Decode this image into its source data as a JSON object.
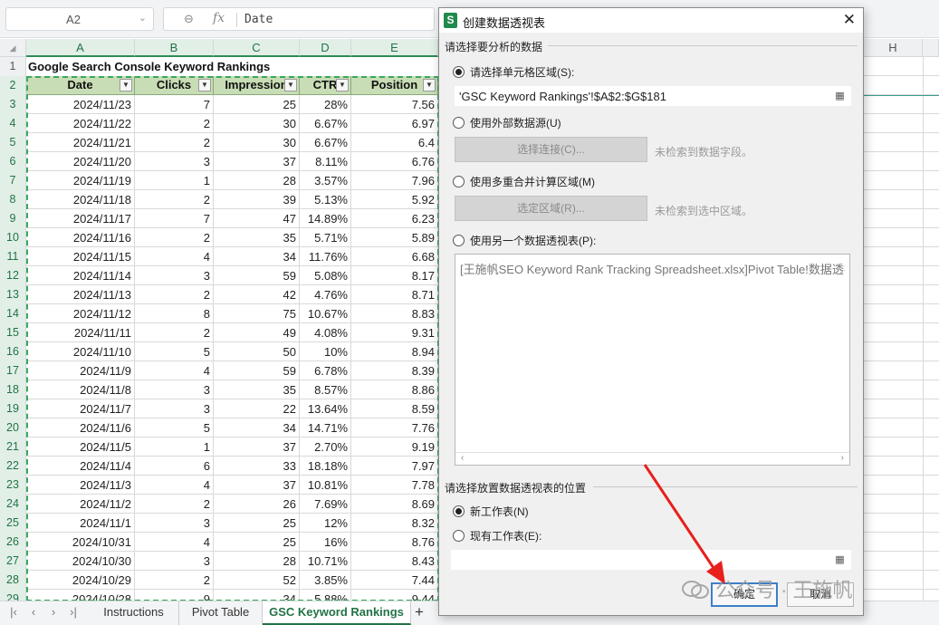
{
  "formula_bar": {
    "name_box": "A2",
    "formula_value": "Date",
    "zoom_icon": "zoom-icon",
    "fx_label": "fx"
  },
  "columns": [
    "A",
    "B",
    "C",
    "D",
    "E",
    "H"
  ],
  "spreadsheet": {
    "title": "Google Search Console Keyword Rankings",
    "headers": [
      "Date",
      "Clicks",
      "Impression",
      "CTR",
      "Position"
    ],
    "row_numbers": [
      "1",
      "2",
      "3",
      "4",
      "5",
      "6",
      "7",
      "8",
      "9",
      "10",
      "11",
      "12",
      "13",
      "14",
      "15",
      "16",
      "17",
      "18",
      "19",
      "20",
      "21",
      "22",
      "23",
      "24",
      "25",
      "26",
      "27",
      "28",
      "29"
    ],
    "rows": [
      [
        "2024/11/23",
        "7",
        "25",
        "28%",
        "7.56"
      ],
      [
        "2024/11/22",
        "2",
        "30",
        "6.67%",
        "6.97"
      ],
      [
        "2024/11/21",
        "2",
        "30",
        "6.67%",
        "6.4"
      ],
      [
        "2024/11/20",
        "3",
        "37",
        "8.11%",
        "6.76"
      ],
      [
        "2024/11/19",
        "1",
        "28",
        "3.57%",
        "7.96"
      ],
      [
        "2024/11/18",
        "2",
        "39",
        "5.13%",
        "5.92"
      ],
      [
        "2024/11/17",
        "7",
        "47",
        "14.89%",
        "6.23"
      ],
      [
        "2024/11/16",
        "2",
        "35",
        "5.71%",
        "5.89"
      ],
      [
        "2024/11/15",
        "4",
        "34",
        "11.76%",
        "6.68"
      ],
      [
        "2024/11/14",
        "3",
        "59",
        "5.08%",
        "8.17"
      ],
      [
        "2024/11/13",
        "2",
        "42",
        "4.76%",
        "8.71"
      ],
      [
        "2024/11/12",
        "8",
        "75",
        "10.67%",
        "8.83"
      ],
      [
        "2024/11/11",
        "2",
        "49",
        "4.08%",
        "9.31"
      ],
      [
        "2024/11/10",
        "5",
        "50",
        "10%",
        "8.94"
      ],
      [
        "2024/11/9",
        "4",
        "59",
        "6.78%",
        "8.39"
      ],
      [
        "2024/11/8",
        "3",
        "35",
        "8.57%",
        "8.86"
      ],
      [
        "2024/11/7",
        "3",
        "22",
        "13.64%",
        "8.59"
      ],
      [
        "2024/11/6",
        "5",
        "34",
        "14.71%",
        "7.76"
      ],
      [
        "2024/11/5",
        "1",
        "37",
        "2.70%",
        "9.19"
      ],
      [
        "2024/11/4",
        "6",
        "33",
        "18.18%",
        "7.97"
      ],
      [
        "2024/11/3",
        "4",
        "37",
        "10.81%",
        "7.78"
      ],
      [
        "2024/11/2",
        "2",
        "26",
        "7.69%",
        "8.69"
      ],
      [
        "2024/11/1",
        "3",
        "25",
        "12%",
        "8.32"
      ],
      [
        "2024/10/31",
        "4",
        "25",
        "16%",
        "8.76"
      ],
      [
        "2024/10/30",
        "3",
        "28",
        "10.71%",
        "8.43"
      ],
      [
        "2024/10/29",
        "2",
        "52",
        "3.85%",
        "7.44"
      ],
      [
        "2024/10/28",
        "9",
        "34",
        "5.88%",
        "9.44"
      ]
    ]
  },
  "sheet_tabs": [
    "Instructions",
    "Pivot Table",
    "GSC Keyword Rankings"
  ],
  "dialog": {
    "title": "创建数据透视表",
    "section_data": "请选择要分析的数据",
    "opt_range": "请选择单元格区域(S):",
    "range_value": "'GSC Keyword Rankings'!$A$2:$G$181",
    "opt_external": "使用外部数据源(U)",
    "btn_choose_connection": "选择连接(C)...",
    "hint_no_fields": "未检索到数据字段。",
    "opt_consolidate": "使用多重合并计算区域(M)",
    "btn_choose_range": "选定区域(R)...",
    "hint_no_range": "未检索到选中区域。",
    "opt_other_pivot": "使用另一个数据透视表(P):",
    "pivot_list_item": "[王施帆SEO Keyword Rank Tracking Spreadsheet.xlsx]Pivot Table!数据透视表",
    "section_location": "请选择放置数据透视表的位置",
    "opt_new_sheet": "新工作表(N)",
    "opt_existing_sheet": "现有工作表(E):",
    "btn_ok": "确定",
    "btn_cancel": "取消"
  },
  "watermark": "公众号 · 王施帆",
  "colors": {
    "header_fill": "#c8ddb5",
    "selection_green": "#217346",
    "marching_ants": "#39a85e",
    "arrow_red": "#e8201c"
  }
}
